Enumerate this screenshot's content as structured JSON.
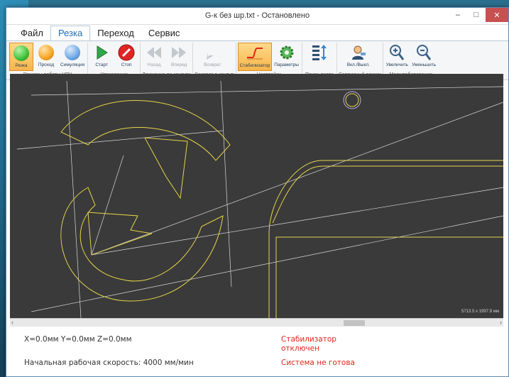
{
  "window": {
    "title": "G-к без шр.txt - Остановлено",
    "minimize_glyph": "–",
    "maximize_glyph": "□",
    "close_glyph": "✕"
  },
  "menu": {
    "items": [
      "Файл",
      "Резка",
      "Переход",
      "Сервис"
    ],
    "active": "Резка"
  },
  "ribbon": {
    "groups": [
      {
        "label": "Режимы работы ЧПУ",
        "buttons": [
          {
            "label": "Резка",
            "icon": "green-circle-icon",
            "color": "#3ec13a",
            "pressed": true
          },
          {
            "label": "Проход",
            "icon": "orange-circle-icon",
            "color": "#f5a623",
            "pressed": false
          },
          {
            "label": "Симуляция",
            "icon": "blue-circle-icon",
            "color": "#6ea8e6",
            "pressed": false
          }
        ]
      },
      {
        "label": "Управление",
        "buttons": [
          {
            "label": "Старт",
            "icon": "play-icon",
            "color": "#2ea84a"
          },
          {
            "label": "Стоп",
            "icon": "stop-icon",
            "color": "#e02424"
          }
        ]
      },
      {
        "label": "Движение по контуру",
        "buttons": [
          {
            "label": "Назад",
            "icon": "rewind-icon",
            "disabled": true
          },
          {
            "label": "Вперед",
            "icon": "forward-icon",
            "disabled": true
          }
        ]
      },
      {
        "label": "Возврат в контур",
        "buttons": [
          {
            "label": "Возврат",
            "icon": "return-arrow-icon",
            "disabled": true
          }
        ]
      },
      {
        "label": "Настройки",
        "buttons": [
          {
            "label": "Стабилизатор",
            "icon": "stabilizer-icon",
            "pressed": true
          },
          {
            "label": "Параметры",
            "icon": "gear-icon"
          }
        ]
      },
      {
        "label": "Поиск листа",
        "buttons": [
          {
            "label": "",
            "icon": "sheet-search-icon"
          }
        ]
      },
      {
        "label": "Сервисный режим",
        "buttons": [
          {
            "label": "Вкл./Выкл.",
            "icon": "service-user-icon"
          }
        ]
      },
      {
        "label": "Масштабирование",
        "buttons": [
          {
            "label": "Увеличить",
            "icon": "zoom-in-icon"
          },
          {
            "label": "Уменьшить",
            "icon": "zoom-out-icon"
          }
        ]
      }
    ]
  },
  "canvas": {
    "dimensions_label": "5713.5 x 1997.8 мм",
    "background": "#3a3a3a",
    "contour_color": "#e6d44a",
    "path_color": "#d9d9d9"
  },
  "status": {
    "coords": "X=0.0мм  Y=0.0мм  Z=0.0мм",
    "speed": "Начальная рабочая скорость: 4000 мм/мин",
    "stabilizer_line1": "Стабилизатор",
    "stabilizer_line2": "отключен",
    "system": "Система не готова"
  }
}
